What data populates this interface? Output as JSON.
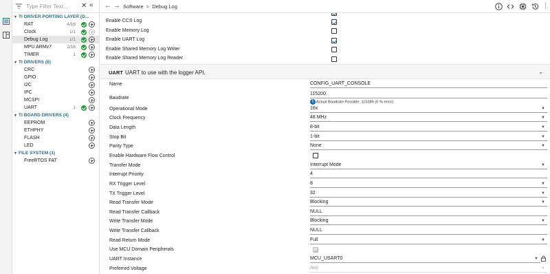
{
  "activity": {
    "icons": [
      "outline-icon",
      "board-icon"
    ]
  },
  "sidebar": {
    "filter_placeholder": "Type Filter Text...",
    "groups": [
      {
        "title": "TI DRIVER PORTING LAYER (D...",
        "items": [
          {
            "label": "RAT",
            "count": "4/16",
            "status": "ok"
          },
          {
            "label": "Clock",
            "count": "1/1",
            "status": "ok",
            "add_disabled": true
          },
          {
            "label": "Debug Log",
            "count": "1/1",
            "status": "ok",
            "selected": true
          },
          {
            "label": "MPU ARMv7",
            "count": "2/16",
            "status": "ok"
          },
          {
            "label": "TIMER",
            "count": "1",
            "status": "ok"
          }
        ]
      },
      {
        "title": "TI DRIVERS (6)",
        "items": [
          {
            "label": "CRC"
          },
          {
            "label": "GPIO"
          },
          {
            "label": "I2C"
          },
          {
            "label": "IPC"
          },
          {
            "label": "MCSPI"
          },
          {
            "label": "UART",
            "count": "1",
            "status": "ok"
          }
        ]
      },
      {
        "title": "TI BOARD DRIVERS (4)",
        "items": [
          {
            "label": "EEPROM"
          },
          {
            "label": "ETHPHY"
          },
          {
            "label": "FLASH"
          },
          {
            "label": "LED"
          }
        ]
      },
      {
        "title": "FILE SYSTEM (1)",
        "items": [
          {
            "label": "FreeRTOS FAT"
          }
        ]
      }
    ]
  },
  "breadcrumb": {
    "part1": "Software",
    "sep": ">",
    "part2": "Debug Log"
  },
  "logs": [
    {
      "label": "Enable CCS Log",
      "checked": true
    },
    {
      "label": "Enable Memory Log",
      "checked": false
    },
    {
      "label": "Enable UART Log",
      "checked": true
    },
    {
      "label": "Enable Shared Memory Log Writer",
      "checked": false
    },
    {
      "label": "Enable Shared Memory Log Reader",
      "checked": false
    }
  ],
  "uart": {
    "tag": "UART",
    "desc": "UART to use with the logger API.",
    "baud_hint": "Actual Baudrate Possible: 115385 (0 % error)",
    "props": [
      {
        "label": "Name",
        "value": "CONFIG_UART_CONSOLE",
        "kind": "text"
      },
      {
        "label": "Baudrate",
        "value": "115200",
        "kind": "text"
      },
      {
        "label": "Operational Mode",
        "value": "16x",
        "kind": "select"
      },
      {
        "label": "Clock Frequency",
        "value": "48 MHz",
        "kind": "select"
      },
      {
        "label": "Data Length",
        "value": "8-bit",
        "kind": "select"
      },
      {
        "label": "Stop Bit",
        "value": "1-bit",
        "kind": "select"
      },
      {
        "label": "Parity Type",
        "value": "None",
        "kind": "select"
      },
      {
        "label": "Enable Hardware Flow Control",
        "value": "",
        "kind": "checkbox",
        "checked": false
      },
      {
        "label": "Transfer Mode",
        "value": "Interrupt Mode",
        "kind": "select"
      },
      {
        "label": "Interrupt Priority",
        "value": "4",
        "kind": "text"
      },
      {
        "label": "RX Trigger Level",
        "value": "8",
        "kind": "select"
      },
      {
        "label": "TX Trigger Level",
        "value": "32",
        "kind": "select"
      },
      {
        "label": "Read Transfer Mode",
        "value": "Blocking",
        "kind": "select"
      },
      {
        "label": "Read Transfer Callback",
        "value": "NULL",
        "kind": "text"
      },
      {
        "label": "Write Transfer Mode",
        "value": "Blocking",
        "kind": "select"
      },
      {
        "label": "Write Transfer Callback",
        "value": "NULL",
        "kind": "text"
      },
      {
        "label": "Read Return Mode",
        "value": "Full",
        "kind": "select"
      },
      {
        "label": "Use MCU Domain Peripherals",
        "value": "",
        "kind": "checkbox-disabled",
        "checked": true
      },
      {
        "label": "UART Instance",
        "value": "MCU_USART0",
        "kind": "select-locked"
      },
      {
        "label": "Preferred Voltage",
        "value": "Any",
        "kind": "select-disabled"
      }
    ]
  },
  "colors": {
    "accent": "#1a6fb3",
    "ok_green": "#2b9a3c",
    "group_text": "#2b6f8a"
  }
}
